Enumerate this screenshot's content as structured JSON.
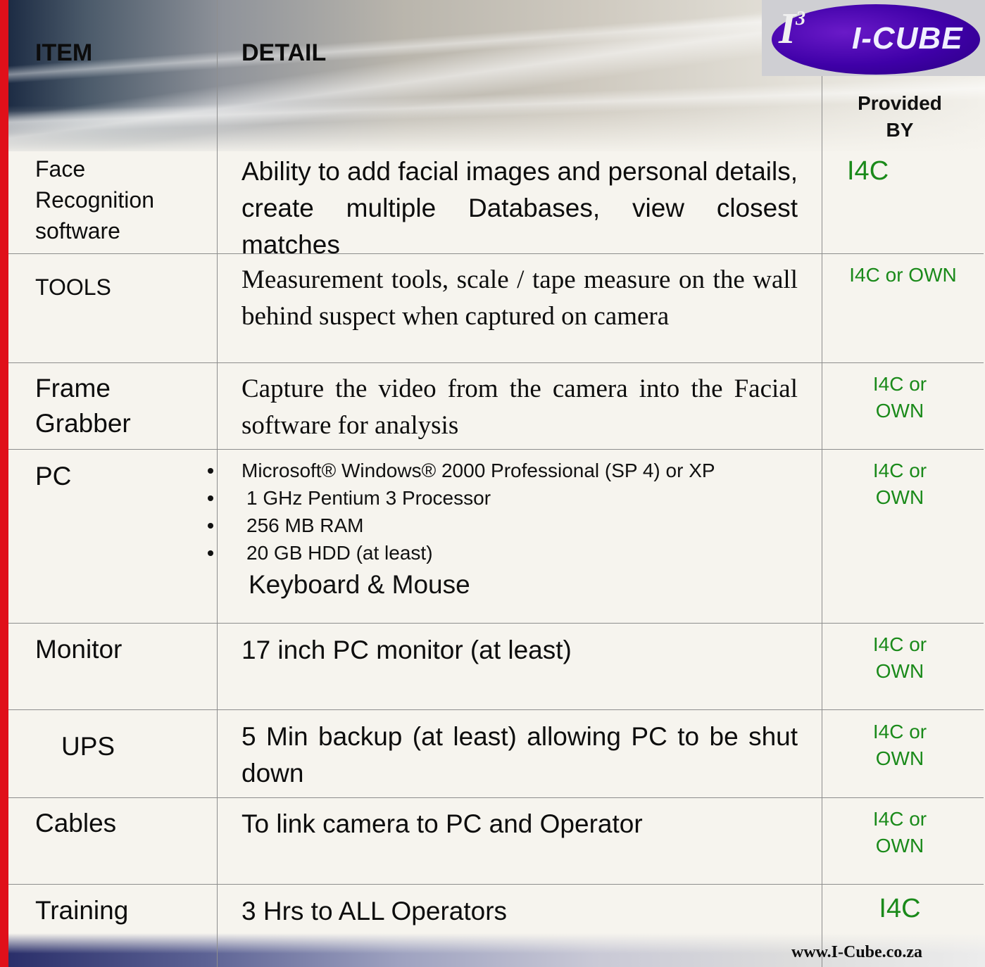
{
  "header": {
    "item": "ITEM",
    "detail": "DETAIL",
    "provided_by_line1": "Provided",
    "provided_by_line2": "BY"
  },
  "logo": {
    "mark": "I",
    "mark_sup": "3",
    "text": "I-CUBE"
  },
  "rows": [
    {
      "item_lines": [
        "Face",
        "Recognition",
        "software"
      ],
      "detail_lines": [
        "Ability to add facial images and personal details, create multiple Databases, view closest matches"
      ],
      "provided": "I4C"
    },
    {
      "item": "TOOLS",
      "detail": "Measurement tools, scale /  tape measure on the wall behind suspect when captured on camera",
      "provided": "I4C or OWN"
    },
    {
      "item_lines": [
        "Frame",
        "Grabber"
      ],
      "detail": "Capture the video from the camera into the Facial software for analysis",
      "provided_lines": [
        "I4C or",
        "OWN"
      ]
    },
    {
      "item": "PC",
      "bullets": [
        "Microsoft® Windows® 2000 Professional (SP 4) or XP",
        "1 GHz Pentium 3 Processor",
        "256 MB RAM",
        "20 GB HDD (at least)"
      ],
      "extra": "Keyboard & Mouse",
      "provided_lines": [
        "I4C or",
        "OWN"
      ]
    },
    {
      "item": "Monitor",
      "detail": "17 inch PC monitor (at least)",
      "provided_lines": [
        "I4C or",
        "OWN"
      ]
    },
    {
      "item": "UPS",
      "detail": "5 Min backup (at least) allowing PC to be shut down",
      "provided_lines": [
        "I4C or",
        "OWN"
      ]
    },
    {
      "item": "Cables",
      "detail": "To link camera to PC and Operator",
      "provided_lines": [
        "I4C or",
        "OWN"
      ]
    },
    {
      "item": "Training",
      "detail": "3 Hrs to ALL Operators",
      "provided": "I4C"
    }
  ],
  "footer": {
    "url": "www.I-Cube.co.za"
  },
  "colors": {
    "provided_text": "#1a8a1a",
    "left_stripe": "#e0101a",
    "logo_ellipse": "#3f00a8"
  }
}
